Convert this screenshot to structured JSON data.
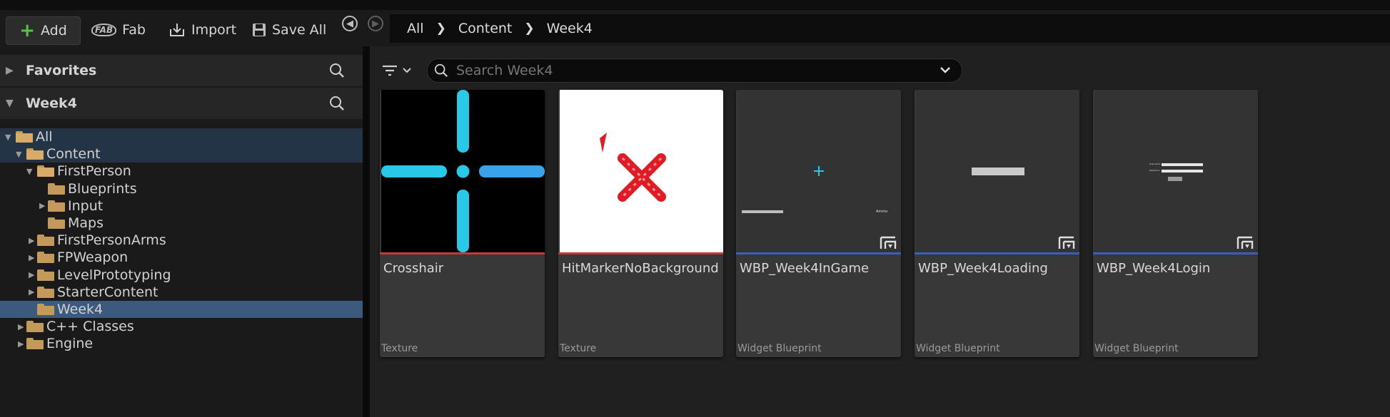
{
  "toolbar": {
    "add_label": "Add",
    "fab_label": "Fab",
    "fab_icon_text": "FAB",
    "import_label": "Import",
    "save_all_label": "Save All"
  },
  "breadcrumb": [
    "All",
    "Content",
    "Week4"
  ],
  "favorites": {
    "title": "Favorites"
  },
  "project": {
    "title": "Week4"
  },
  "tree": [
    {
      "label": "All",
      "depth": 0,
      "expanded": true,
      "state": "highlight"
    },
    {
      "label": "Content",
      "depth": 1,
      "expanded": true,
      "state": "highlight"
    },
    {
      "label": "FirstPerson",
      "depth": 2,
      "expanded": true,
      "state": ""
    },
    {
      "label": "Blueprints",
      "depth": 3,
      "expanded": null,
      "state": ""
    },
    {
      "label": "Input",
      "depth": 3,
      "expanded": false,
      "state": ""
    },
    {
      "label": "Maps",
      "depth": 3,
      "expanded": null,
      "state": ""
    },
    {
      "label": "FirstPersonArms",
      "depth": 2,
      "expanded": false,
      "state": ""
    },
    {
      "label": "FPWeapon",
      "depth": 2,
      "expanded": false,
      "state": ""
    },
    {
      "label": "LevelPrototyping",
      "depth": 2,
      "expanded": false,
      "state": ""
    },
    {
      "label": "StarterContent",
      "depth": 2,
      "expanded": false,
      "state": ""
    },
    {
      "label": "Week4",
      "depth": 2,
      "expanded": null,
      "state": "selected"
    },
    {
      "label": "C++ Classes",
      "depth": 1,
      "expanded": false,
      "state": ""
    },
    {
      "label": "Engine",
      "depth": 1,
      "expanded": false,
      "state": ""
    }
  ],
  "search": {
    "placeholder": "Search Week4"
  },
  "assets": [
    {
      "name": "Crosshair",
      "type": "Texture",
      "bar_color": "#c0393b"
    },
    {
      "name": "HitMarkerNoBackground",
      "type": "Texture",
      "bar_color": "#c0393b"
    },
    {
      "name": "WBP_Week4InGame",
      "type": "Widget Blueprint",
      "bar_color": "#3b5fc0",
      "preview_text": "Ammo"
    },
    {
      "name": "WBP_Week4Loading",
      "type": "Widget Blueprint",
      "bar_color": "#3b5fc0"
    },
    {
      "name": "WBP_Week4Login",
      "type": "Widget Blueprint",
      "bar_color": "#3b5fc0",
      "preview_labels": [
        "Username",
        "Password"
      ]
    }
  ],
  "colors": {
    "accent_add": "#58c24a",
    "folder": "#c49a5a",
    "selection": "#3b5a7e",
    "crosshair": "#29c7e8"
  }
}
